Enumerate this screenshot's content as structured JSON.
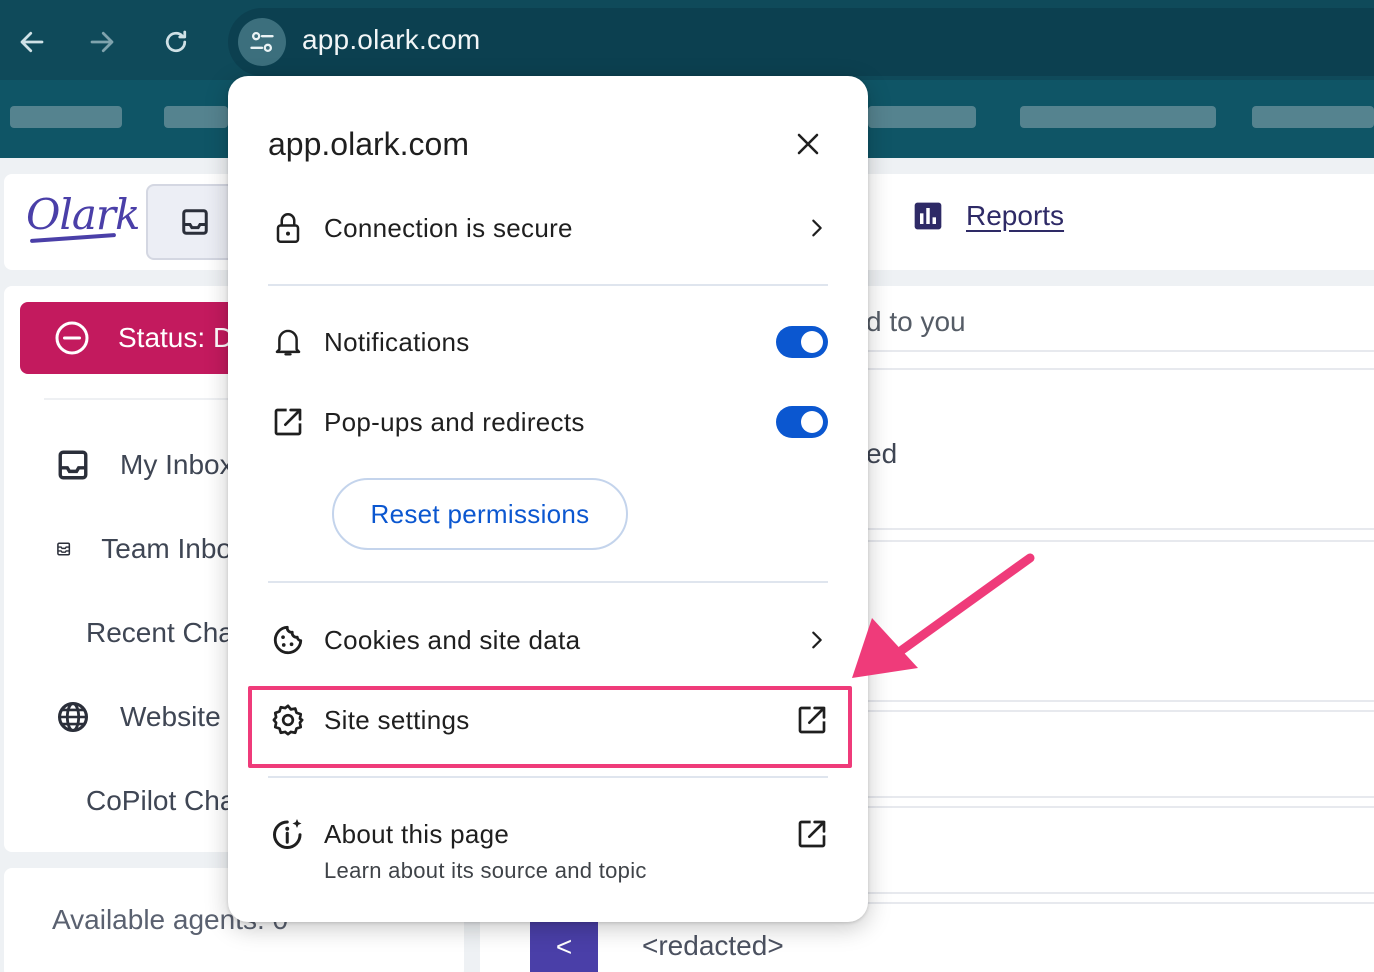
{
  "browser": {
    "url": "app.olark.com",
    "nav_icons": [
      "back-arrow-icon",
      "forward-arrow-icon",
      "reload-icon",
      "tune-icon"
    ]
  },
  "app": {
    "logo_text": "Olark",
    "header": {
      "reports_label": "Reports"
    },
    "status_label": "Status: D",
    "sidebar_items": [
      {
        "label": "My Inbox",
        "icon": "inbox-icon"
      },
      {
        "label": "Team Inbox",
        "icon": "team-inbox-icon"
      },
      {
        "label": "Recent Chats",
        "icon": "history-icon"
      },
      {
        "label": "Website",
        "icon": "globe-icon"
      },
      {
        "label": "CoPilot Chats",
        "icon": "inbox-icon"
      }
    ],
    "agents_label": "Available agents: 0",
    "main": {
      "assigned_text": "d to you",
      "row_text": "ed",
      "back_label": "<",
      "redacted_label": "<redacted>"
    }
  },
  "popup": {
    "title": "app.olark.com",
    "connection_label": "Connection is secure",
    "notifications_label": "Notifications",
    "notifications_on": true,
    "popups_label": "Pop-ups and redirects",
    "popups_on": true,
    "reset_label": "Reset permissions",
    "cookies_label": "Cookies and site data",
    "site_settings_label": "Site settings",
    "about_label": "About this page",
    "about_sub": "Learn about its source and topic"
  },
  "colors": {
    "chrome_bg": "#0f4a5a",
    "status_bg": "#c31a5e",
    "toggle_on": "#0b57d0",
    "highlight": "#ef3b7a",
    "brand": "#4a3fa8"
  }
}
